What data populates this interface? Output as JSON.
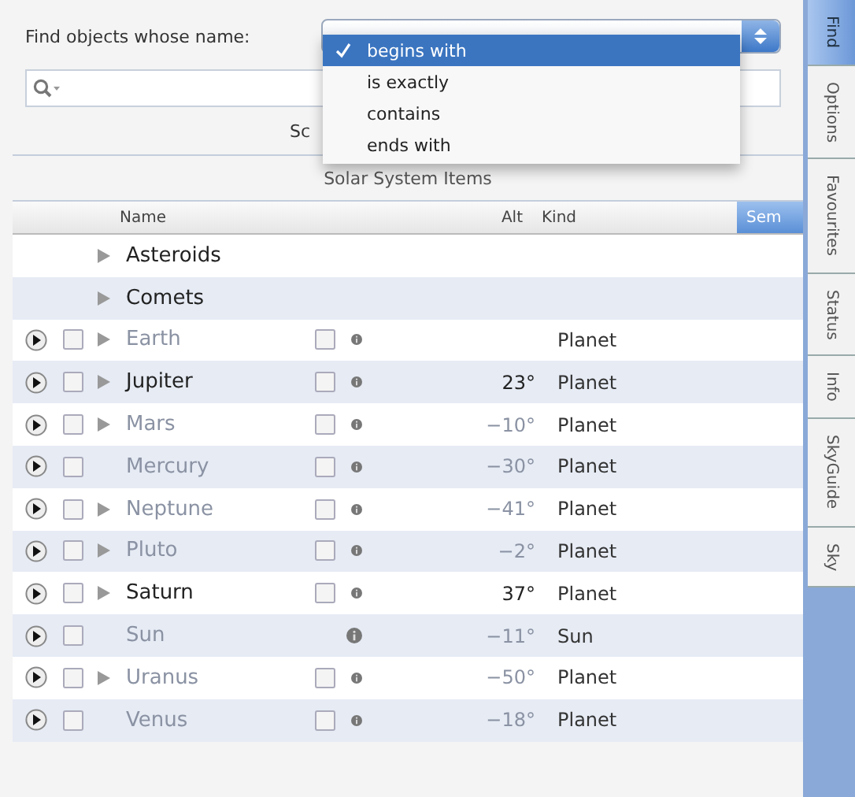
{
  "find_bar": {
    "label": "Find objects whose name:",
    "match_menu": [
      {
        "label": "begins with",
        "selected": true
      },
      {
        "label": "is exactly",
        "selected": false
      },
      {
        "label": "contains",
        "selected": false
      },
      {
        "label": "ends with",
        "selected": false
      }
    ]
  },
  "scope_label": "Sc",
  "section_title": "Solar System Items",
  "columns": [
    {
      "label": "Name",
      "selected": false
    },
    {
      "label": "Alt",
      "selected": false
    },
    {
      "label": "Kind",
      "selected": false
    },
    {
      "label": "Sem",
      "selected": true
    }
  ],
  "groups": [
    {
      "name": "Asteroids"
    },
    {
      "name": "Comets"
    }
  ],
  "rows": [
    {
      "checked": false,
      "name": "Earth",
      "dimmed": true,
      "expandable": true,
      "has_view_box": true,
      "object_type": "Planet"
    },
    {
      "checked": false,
      "name": "Jupiter",
      "dimmed": false,
      "expandable": true,
      "has_view_box": true,
      "alt": "23°",
      "object_type": "Planet"
    },
    {
      "checked": false,
      "name": "Mars",
      "dimmed": true,
      "expandable": true,
      "has_view_box": true,
      "alt": "−10°",
      "object_type": "Planet"
    },
    {
      "checked": false,
      "name": "Mercury",
      "dimmed": true,
      "expandable": false,
      "has_view_box": true,
      "alt": "−30°",
      "object_type": "Planet"
    },
    {
      "checked": false,
      "name": "Neptune",
      "dimmed": true,
      "expandable": true,
      "has_view_box": true,
      "alt": "−41°",
      "object_type": "Planet"
    },
    {
      "checked": false,
      "name": "Pluto",
      "dimmed": true,
      "expandable": true,
      "has_view_box": true,
      "alt": "−2°",
      "object_type": "Planet"
    },
    {
      "checked": false,
      "name": "Saturn",
      "dimmed": false,
      "expandable": true,
      "has_view_box": true,
      "alt": "37°",
      "object_type": "Planet"
    },
    {
      "checked": false,
      "name": "Sun",
      "dimmed": true,
      "expandable": false,
      "has_view_box": false,
      "alt": "−11°",
      "object_type": "Sun"
    },
    {
      "checked": false,
      "name": "Uranus",
      "dimmed": true,
      "expandable": true,
      "has_view_box": true,
      "alt": "−50°",
      "object_type": "Planet"
    },
    {
      "checked": false,
      "name": "Venus",
      "dimmed": true,
      "expandable": false,
      "has_view_box": true,
      "alt": "−18°",
      "object_type": "Planet"
    }
  ],
  "side_tabs": [
    {
      "label": "Find",
      "selected": true
    },
    {
      "label": "Options",
      "selected": false
    },
    {
      "label": "Favourites",
      "selected": false
    },
    {
      "label": "Status",
      "selected": false
    },
    {
      "label": "Info",
      "selected": false
    },
    {
      "label": "SkyGuide",
      "selected": false
    },
    {
      "label": "Sky",
      "selected": false
    }
  ]
}
